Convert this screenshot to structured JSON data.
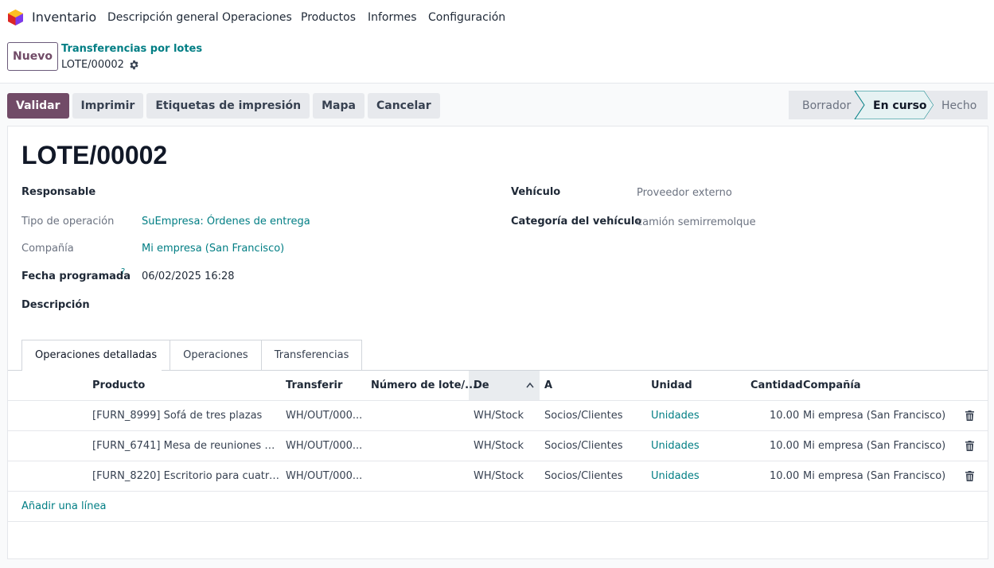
{
  "app": {
    "name": "Inventario"
  },
  "menu": [
    "Descripción general",
    "Operaciones",
    "Productos",
    "Informes",
    "Configuración"
  ],
  "control_panel": {
    "new_label": "Nuevo",
    "breadcrumb_parent": "Transferencias por lotes",
    "breadcrumb_current": "LOTE/00002"
  },
  "actions": [
    "Validar",
    "Imprimir",
    "Etiquetas de impresión",
    "Mapa",
    "Cancelar"
  ],
  "status": {
    "stages": [
      "Borrador",
      "En curso",
      "Hecho"
    ],
    "current": "En curso"
  },
  "form": {
    "title": "LOTE/00002",
    "responsable_label": "Responsable",
    "tipo_label": "Tipo de operación",
    "tipo_value": "SuEmpresa: Órdenes de entrega",
    "compania_label": "Compañía",
    "compania_value": "Mi empresa (San Francisco)",
    "fecha_label": "Fecha programada",
    "fecha_help": "?",
    "fecha_value": "06/02/2025 16:28",
    "descripcion_label": "Descripción",
    "vehiculo_label": "Vehículo",
    "vehiculo_value": "Proveedor externo",
    "categoria_label": "Categoría del vehículo",
    "categoria_value": "camión semirremolque"
  },
  "tabs": [
    "Operaciones detalladas",
    "Operaciones",
    "Transferencias"
  ],
  "table": {
    "headers": [
      "Producto",
      "Transferir",
      "Número de lote/...",
      "De",
      "A",
      "Unidad",
      "Cantidad",
      "Compañía"
    ],
    "rows": [
      [
        "[FURN_8999] Sofá de tres plazas",
        "WH/OUT/000...",
        "",
        "WH/Stock",
        "Socios/Clientes",
        "Unidades",
        "10.00",
        "Mi empresa (San Francisco)"
      ],
      [
        "[FURN_6741] Mesa de reuniones gr...",
        "WH/OUT/000...",
        "",
        "WH/Stock",
        "Socios/Clientes",
        "Unidades",
        "10.00",
        "Mi empresa (San Francisco)"
      ],
      [
        "[FURN_8220] Escritorio para cuatro ...",
        "WH/OUT/000...",
        "",
        "WH/Stock",
        "Socios/Clientes",
        "Unidades",
        "10.00",
        "Mi empresa (San Francisco)"
      ]
    ],
    "add_line": "Añadir una línea"
  },
  "colors": {
    "primary": "#714b67",
    "link": "#017e84"
  },
  "icons": [
    "app-logo-icon",
    "gear-icon",
    "sort-up-icon",
    "trash-icon"
  ]
}
